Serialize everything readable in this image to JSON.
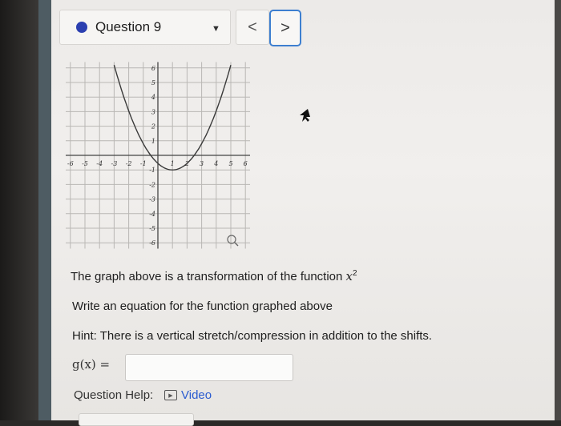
{
  "question": {
    "label": "Question 9",
    "status_color": "#2b3fb0",
    "dropdown_icon": "caret-down-icon",
    "prev_label": "<",
    "next_label": ">"
  },
  "graph": {
    "x_ticks": [
      "-6",
      "-5",
      "-4",
      "-3",
      "-2",
      "-1",
      "1",
      "2",
      "3",
      "4",
      "5",
      "6"
    ],
    "y_ticks": [
      "6",
      "5",
      "4",
      "3",
      "2",
      "1",
      "-1",
      "-2",
      "-3",
      "-4",
      "-5",
      "-6"
    ],
    "zoom_icon": "magnifier-icon"
  },
  "prompt": {
    "line1_text": "The graph above is a transformation of the function ",
    "line1_math": "x",
    "line1_exp": "2",
    "line2": "Write an equation for the function graphed above",
    "line3": "Hint: There is a vertical stretch/compression in addition to the shifts."
  },
  "answer": {
    "label": "g(x) =",
    "value": ""
  },
  "help": {
    "label": "Question Help:",
    "video_label": "Video",
    "video_icon": "play-video-icon"
  }
}
